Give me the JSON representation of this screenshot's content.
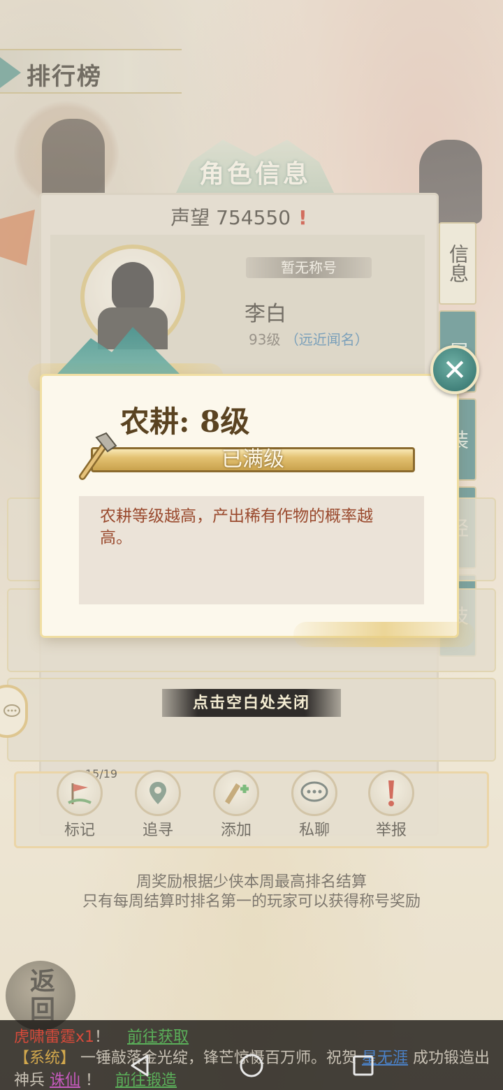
{
  "header": {
    "title": "排行榜"
  },
  "character_panel": {
    "banner_title": "角色信息",
    "prestige_label": "声望",
    "prestige_value": "754550",
    "alert_glyph": "!",
    "title_plate": "暂无称号",
    "player_name": "李白",
    "player_level": "93级",
    "player_tag": "（远近闻名）",
    "side_tabs": [
      "信息",
      "属",
      "装",
      "经",
      "技"
    ]
  },
  "popup": {
    "skill_name": "农耕: 8级",
    "level_bar_text": "已满级",
    "description": "农耕等级越高，产出稀有作物的概率越高。",
    "close_hint": "点击空白处关闭"
  },
  "actions": {
    "mark_count": "15/19",
    "items": [
      {
        "label": "标记",
        "icon": "flag-icon"
      },
      {
        "label": "追寻",
        "icon": "location-pin-icon"
      },
      {
        "label": "添加",
        "icon": "add-friend-icon"
      },
      {
        "label": "私聊",
        "icon": "chat-icon"
      },
      {
        "label": "举报",
        "icon": "report-icon"
      }
    ]
  },
  "weekly": {
    "line1": "周奖励根据少侠本周最高排名结算",
    "line2": "只有每周结算时排名第一的玩家可以获得称号奖励"
  },
  "return_button": "返回",
  "chat": {
    "line1_item": "虎啸雷霆x1",
    "line1_sep": "！",
    "line1_link": "前往获取",
    "line2_prefix": "【系统】",
    "line2_text": "一锤敲落金光绽，锋芒惊慑百万师。祝贺",
    "line2_name": "星无涯",
    "line2_suffix": "成功锻造出",
    "line3_prefix": "神兵",
    "line3_item": "诛仙",
    "line3_sep": "！",
    "line3_link": "前往锻造"
  },
  "colors": {
    "accent_teal": "#3e7d80",
    "gold": "#c9a24d",
    "alert_red": "#c22a1b",
    "desc_text": "#9a4a2e"
  }
}
